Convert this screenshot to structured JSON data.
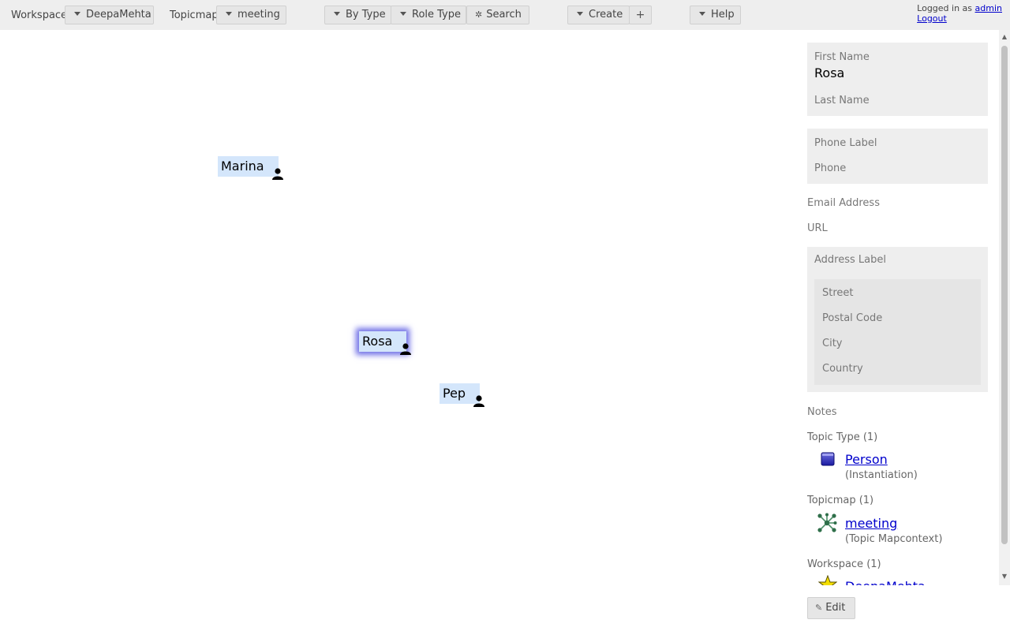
{
  "toolbar": {
    "workspace_label": "Workspace",
    "workspace_value": "DeepaMehta",
    "topicmap_label": "Topicmap",
    "topicmap_value": "meeting",
    "by_type": "By Type",
    "role_type": "Role Type",
    "search": "Search",
    "create": "Create",
    "add": "+",
    "help": "Help"
  },
  "login": {
    "prefix": "Logged in as",
    "user": "admin",
    "logout": "Logout"
  },
  "canvas": {
    "topics": [
      {
        "label": "Marina",
        "icon": "person-icon",
        "selected": false
      },
      {
        "label": "Rosa",
        "icon": "person-icon",
        "selected": true
      },
      {
        "label": "Pep",
        "icon": "person-icon",
        "selected": false
      }
    ],
    "selection_glow_color": "#6f6fe6",
    "topic_bg_color": "#d4e6fb"
  },
  "detail": {
    "first_name_label": "First Name",
    "first_name_value": "Rosa",
    "last_name_label": "Last Name",
    "phone_label_label": "Phone Label",
    "phone_label": "Phone",
    "email_label": "Email Address",
    "url_label": "URL",
    "address_label_label": "Address Label",
    "street_label": "Street",
    "postal_code_label": "Postal Code",
    "city_label": "City",
    "country_label": "Country",
    "notes_label": "Notes",
    "topic_type_header": "Topic Type (1)",
    "topic_type_name": "Person",
    "topic_type_relation": "(Instantiation)",
    "topicmap_header": "Topicmap (1)",
    "topicmap_name": "meeting",
    "topicmap_relation": "(Topic Mapcontext)",
    "workspace_header": "Workspace (1)",
    "workspace_name": "DeepaMehta",
    "edit_label": "Edit"
  },
  "icons": {
    "dropdown": "caret-down-icon",
    "search": "gear-icon",
    "edit": "pencil-icon",
    "person": "person-icon",
    "topic_type": "topic-type-icon",
    "topicmap": "topicmap-icon",
    "workspace": "star-icon"
  }
}
